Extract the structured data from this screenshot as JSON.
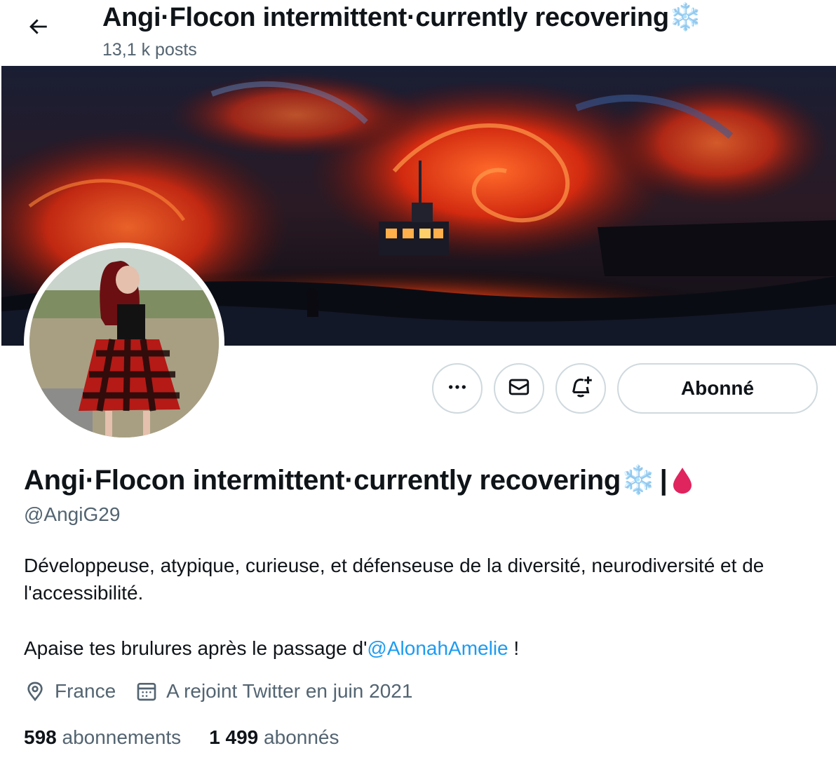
{
  "header": {
    "title": "Angi·Flocon intermittent·currently recovering",
    "title_emoji": "❄️",
    "posts_count": "13,1 k posts"
  },
  "actions": {
    "more_icon": "more-horizontal-icon",
    "message_icon": "envelope-icon",
    "notify_icon": "bell-plus-icon",
    "follow_label": "Abonné"
  },
  "profile": {
    "display_name": "Angi·Flocon intermittent·currently recovering",
    "name_emoji": "❄️",
    "name_separator": "|",
    "name_drop": "🩸",
    "handle": "@AngiG29",
    "bio_line1": "Développeuse, atypique, curieuse, et défenseuse de la diversité, neurodiversité et de l'accessibilité.",
    "bio_line2_prefix": "Apaise tes brulures après le passage d'",
    "bio_mention": "@AlonahAmelie",
    "bio_line2_suffix": " !",
    "location": "France",
    "joined": "A rejoint Twitter en juin 2021"
  },
  "stats": {
    "following_count": "598",
    "following_label": "abonnements",
    "followers_count": "1 499",
    "followers_label": "abonnés"
  },
  "colors": {
    "accent": "#1d9bf0",
    "muted": "#536471",
    "border": "#cfd9de",
    "text": "#0f1419",
    "drop": "#e0245e",
    "snowflake": "#8cc8f2"
  }
}
